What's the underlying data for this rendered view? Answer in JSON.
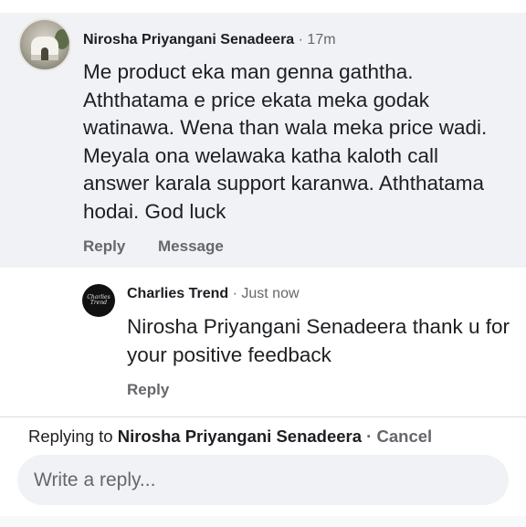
{
  "comment": {
    "author": "Nirosha Priyangani Senadeera",
    "time": "17m",
    "separator": " · ",
    "text": "Me product eka man genna gaththa. Aththatama e price ekata meka godak watinawa. Wena than wala meka price wadi. Meyala ona welawaka katha kaloth call answer karala support karanwa. Aththatama hodai. God luck",
    "actions": {
      "reply": "Reply",
      "message": "Message"
    }
  },
  "reply": {
    "author": "Charlies Trend",
    "time": "Just now",
    "separator": " · ",
    "avatar_logo_line1": "Charlies",
    "avatar_logo_line2": "Trend",
    "text": "Nirosha Priyangani Senadeera thank u for your positive feedback",
    "actions": {
      "reply": "Reply"
    }
  },
  "composer": {
    "replying_prefix": "Replying to ",
    "replying_name": "Nirosha Priyangani Senadeera",
    "separator": " · ",
    "cancel_label": "Cancel",
    "placeholder": "Write a reply..."
  },
  "colors": {
    "comment_bg": "#f0f2f5",
    "secondary_text": "#65676b",
    "primary_text": "#1c1e21"
  }
}
